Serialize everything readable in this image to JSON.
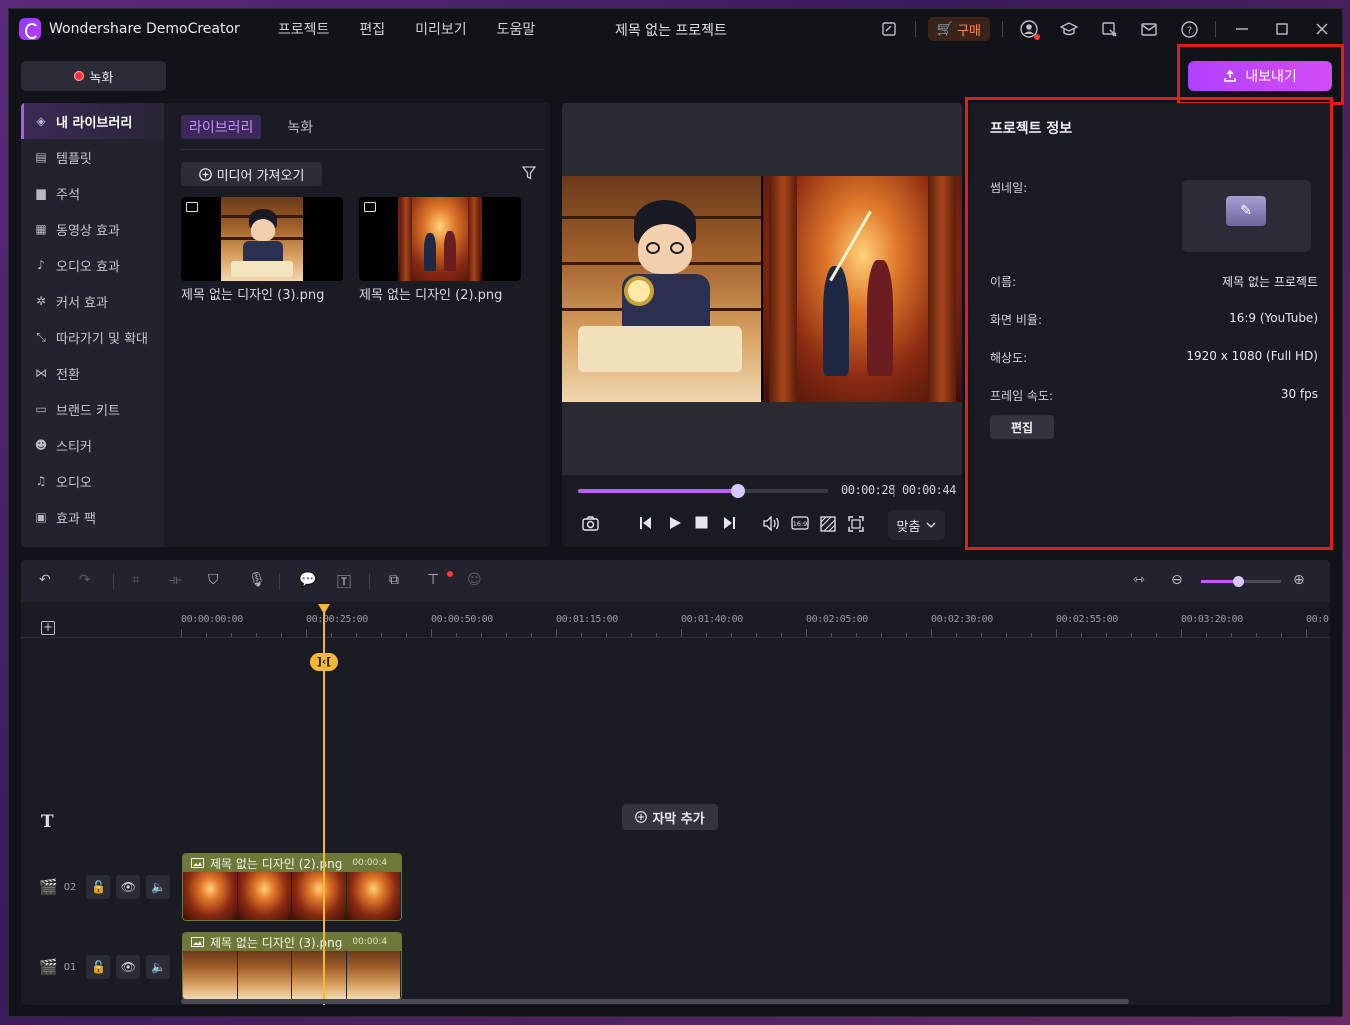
{
  "app": {
    "title": "Wondershare DemoCreator",
    "project_title": "제목 없는 프로젝트",
    "menu": [
      "프로젝트",
      "편집",
      "미리보기",
      "도움말"
    ],
    "buy_label": "구매"
  },
  "record": {
    "label": "녹화"
  },
  "export": {
    "label": "내보내기"
  },
  "sidebar": {
    "items": [
      {
        "label": "내 라이브러리",
        "icon": "layers-icon",
        "active": true
      },
      {
        "label": "템플릿",
        "icon": "template-icon"
      },
      {
        "label": "주석",
        "icon": "annotation-icon"
      },
      {
        "label": "동영상 효과",
        "icon": "video-effect-icon"
      },
      {
        "label": "오디오 효과",
        "icon": "audio-effect-icon"
      },
      {
        "label": "커서 효과",
        "icon": "cursor-effect-icon"
      },
      {
        "label": "따라가기 및 확대",
        "icon": "zoom-follow-icon"
      },
      {
        "label": "전환",
        "icon": "transition-icon"
      },
      {
        "label": "브랜드 키트",
        "icon": "brand-kit-icon"
      },
      {
        "label": "스티커",
        "icon": "sticker-icon"
      },
      {
        "label": "오디오",
        "icon": "music-icon"
      },
      {
        "label": "효과 팩",
        "icon": "effect-pack-icon"
      }
    ]
  },
  "library": {
    "tabs": [
      "라이브러리",
      "녹화"
    ],
    "import_label": "미디어 가져오기",
    "media": [
      {
        "name": "제목 없는 디자인 (3).png"
      },
      {
        "name": "제목 없는 디자인 (2).png"
      }
    ]
  },
  "preview": {
    "current_time": "00:00:28",
    "total_time": "00:00:44",
    "progress": 0.64,
    "fit_label": "맞춤"
  },
  "project_info": {
    "title": "프로젝트 정보",
    "thumbnail_label": "썸네일:",
    "rows": [
      {
        "label": "이름:",
        "value": "제목 없는 프로젝트"
      },
      {
        "label": "화면 비율:",
        "value": "16:9 (YouTube)"
      },
      {
        "label": "해상도:",
        "value": "1920 x 1080 (Full HD)"
      },
      {
        "label": "프레임 속도:",
        "value": "30 fps"
      }
    ],
    "edit_label": "편집"
  },
  "timeline": {
    "ruler": [
      "00:00:00:00",
      "00:00:25:00",
      "00:00:50:00",
      "00:01:15:00",
      "00:01:40:00",
      "00:02:05:00",
      "00:02:30:00",
      "00:02:55:00",
      "00:03:20:00",
      "00:0"
    ],
    "playhead_chip": "]‹[",
    "add_caption_label": "자막 추가",
    "zoom_level": 0.46,
    "tracks": [
      {
        "num": "02",
        "clip": "제목 없는 디자인 (2).png",
        "duration": "00:00:4"
      },
      {
        "num": "01",
        "clip": "제목 없는 디자인 (3).png",
        "duration": "00:00:4"
      }
    ]
  }
}
